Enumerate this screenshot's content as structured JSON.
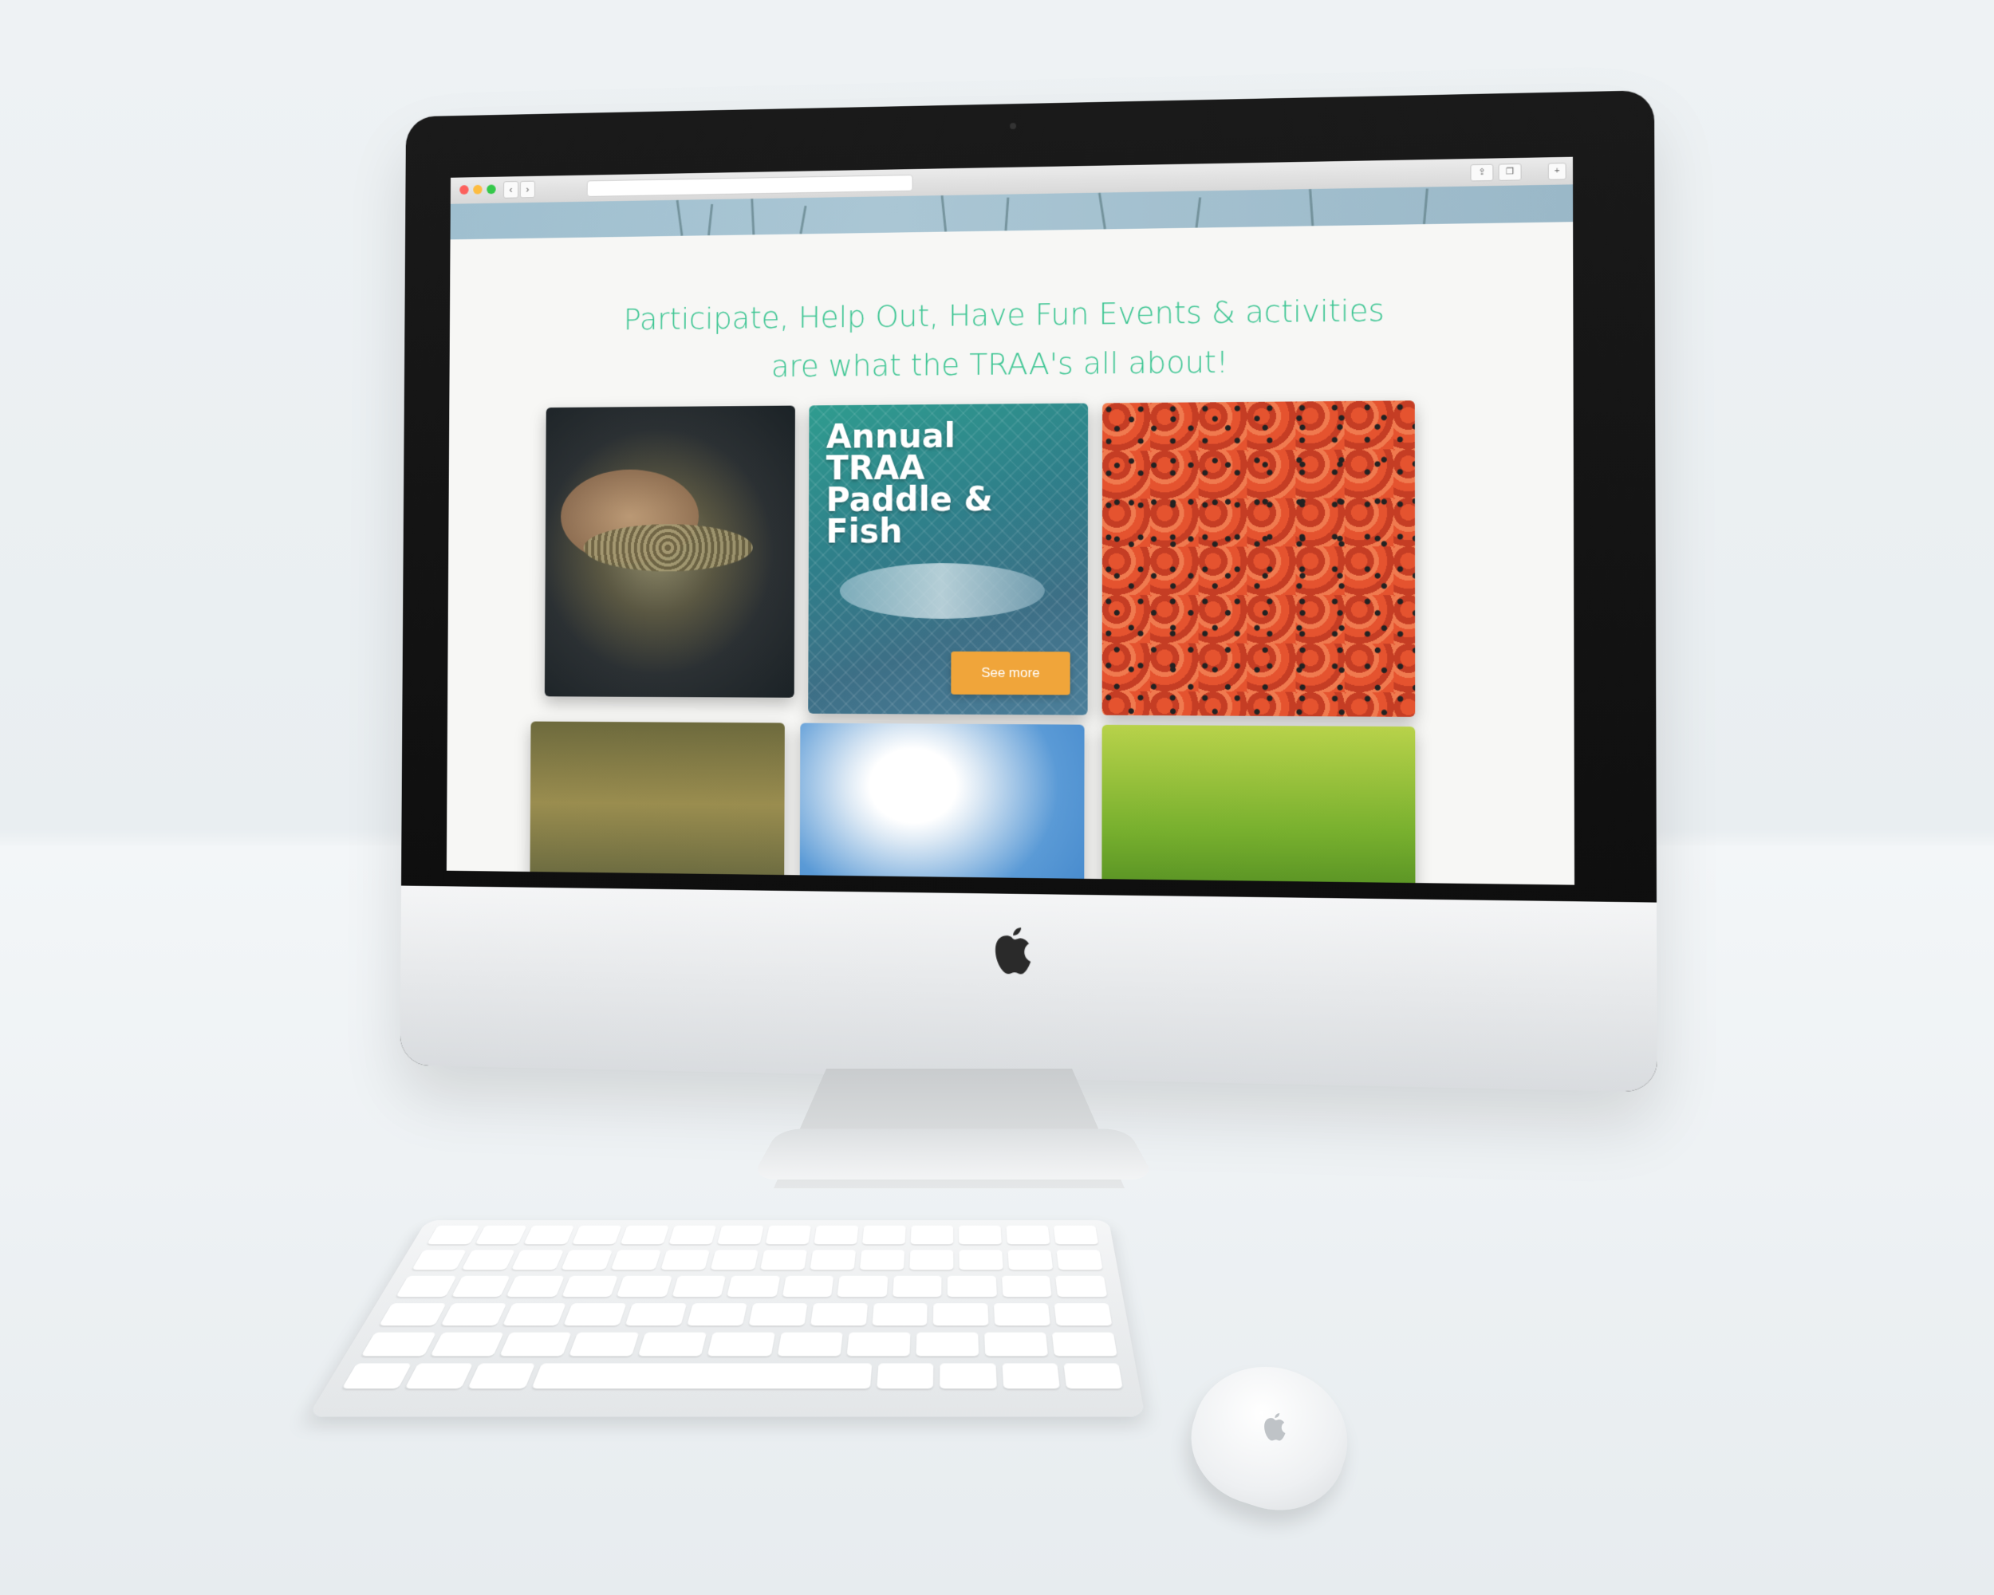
{
  "headline": {
    "line1": "Participate, Help Out, Have Fun Events & activities",
    "line2": "are what the TRAA's all about!"
  },
  "featured_card": {
    "title": "Annual TRAA Paddle & Fish",
    "button_label": "See more"
  },
  "colors": {
    "headline": "#3cc592",
    "button": "#f0a53a"
  },
  "icons": [
    "apple-logo-icon",
    "back-arrow-icon",
    "forward-arrow-icon",
    "share-icon",
    "tabs-icon",
    "new-tab-icon"
  ]
}
